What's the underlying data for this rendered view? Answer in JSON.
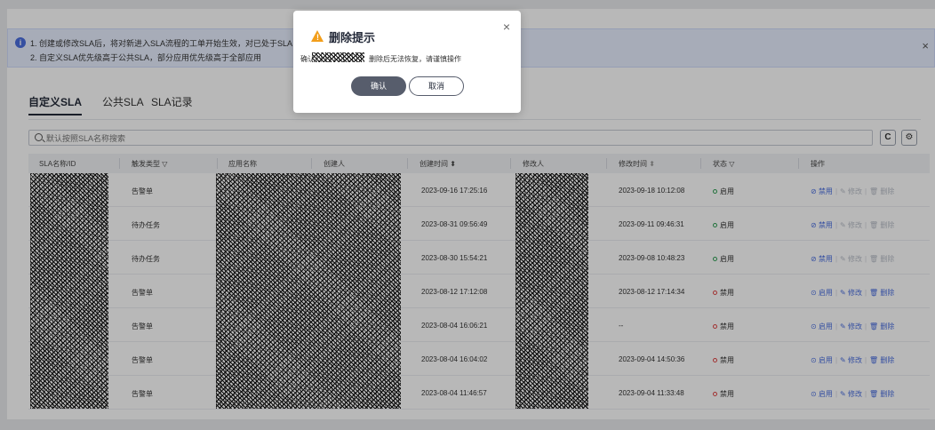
{
  "notice": {
    "line1": "1. 创建或修改SLA后，将对新进入SLA流程的工单开始生效，对已处于SLA",
    "line2": "2. 自定义SLA优先级高于公共SLA，部分应用优先级高于全部应用",
    "close": "×"
  },
  "tabs": [
    "自定义SLA",
    "公共SLA",
    "SLA记录"
  ],
  "search": {
    "placeholder": "默认按照SLA名称搜索"
  },
  "toolbar": {
    "refresh": "C",
    "settings": "⚙"
  },
  "table": {
    "headers": [
      "SLA名称/ID",
      "触发类型",
      "应用名称",
      "创建人",
      "创建时间",
      "修改人",
      "修改时间",
      "状态",
      "操作"
    ],
    "rows": [
      {
        "trigger": "告警单",
        "created": "2023-09-16 17:25:16",
        "modified": "2023-09-18 10:12:08",
        "status": "启用",
        "toggle": "禁用",
        "edit": "修改",
        "del": "删除"
      },
      {
        "trigger": "待办任务",
        "created": "2023-08-31 09:56:49",
        "modified": "2023-09-11 09:46:31",
        "status": "启用",
        "toggle": "禁用",
        "edit": "修改",
        "del": "删除"
      },
      {
        "trigger": "待办任务",
        "created": "2023-08-30 15:54:21",
        "modified": "2023-09-08 10:48:23",
        "status": "启用",
        "toggle": "禁用",
        "edit": "修改",
        "del": "删除"
      },
      {
        "trigger": "告警单",
        "created": "2023-08-12 17:12:08",
        "modified": "2023-08-12 17:14:34",
        "status": "禁用",
        "toggle": "启用",
        "edit": "修改",
        "del": "删除"
      },
      {
        "trigger": "告警单",
        "created": "2023-08-04 16:06:21",
        "modified": "--",
        "status": "禁用",
        "toggle": "启用",
        "edit": "修改",
        "del": "删除"
      },
      {
        "trigger": "告警单",
        "created": "2023-08-04 16:04:02",
        "modified": "2023-09-04 14:50:36",
        "status": "禁用",
        "toggle": "启用",
        "edit": "修改",
        "del": "删除"
      },
      {
        "trigger": "告警单",
        "created": "2023-08-04 11:46:57",
        "modified": "2023-09-04 11:33:48",
        "status": "禁用",
        "toggle": "启用",
        "edit": "修改",
        "del": "删除"
      }
    ]
  },
  "dialog": {
    "title": "删除提示",
    "message_prefix": "确认",
    "message_suffix": "删除后无法恢复，请谨慎操作",
    "confirm": "确认",
    "cancel": "取消",
    "close": "×"
  },
  "colors": {
    "accent": "#4a6ee0",
    "enabled": "#2e9e53",
    "disabled": "#e04444",
    "warning": "#f29e1b"
  }
}
